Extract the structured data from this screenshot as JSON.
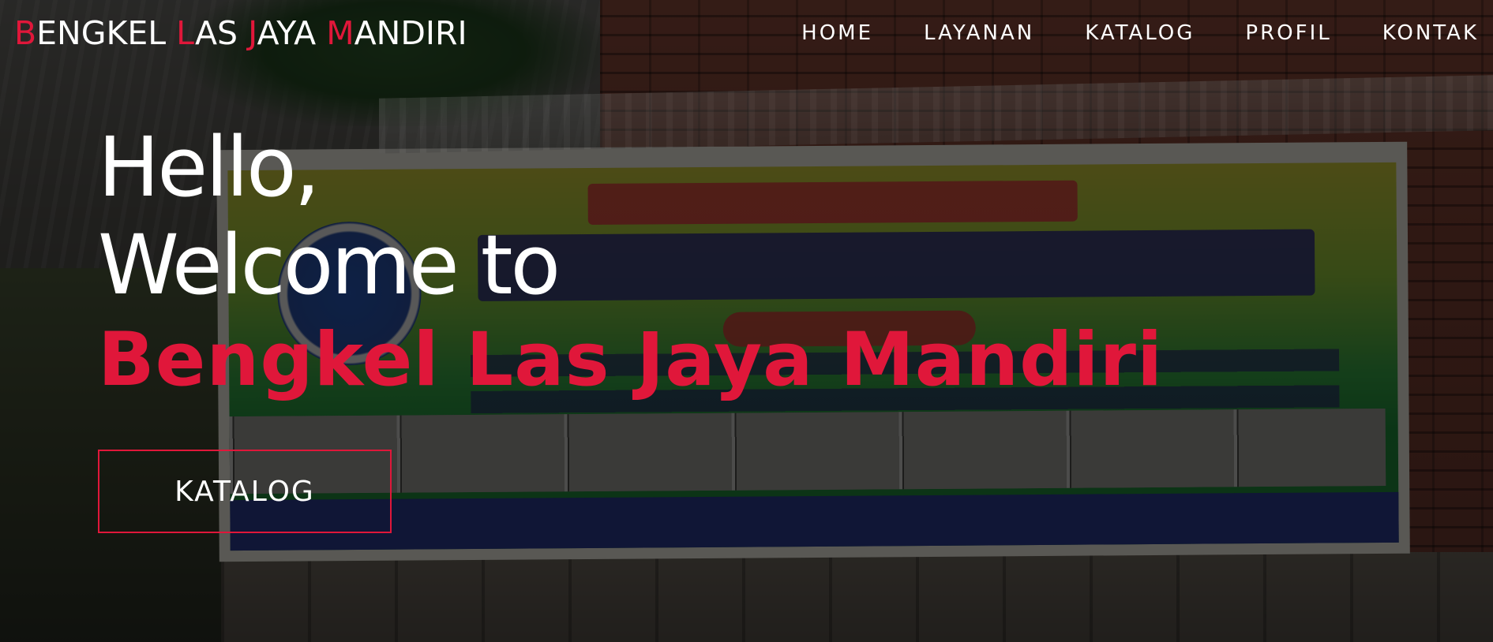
{
  "brand": {
    "parts": [
      {
        "text": "B",
        "accent": true
      },
      {
        "text": "ENGKEL ",
        "accent": false
      },
      {
        "text": "L",
        "accent": true
      },
      {
        "text": "AS ",
        "accent": false
      },
      {
        "text": "J",
        "accent": true
      },
      {
        "text": "AYA ",
        "accent": false
      },
      {
        "text": "M",
        "accent": true
      },
      {
        "text": "ANDIRI",
        "accent": false
      }
    ]
  },
  "nav": {
    "items": [
      {
        "label": "HOME"
      },
      {
        "label": "LAYANAN"
      },
      {
        "label": "KATALOG"
      },
      {
        "label": "PROFIL"
      },
      {
        "label": "KONTAK"
      }
    ]
  },
  "hero": {
    "line1": "Hello,",
    "line2": "Welcome to",
    "company": "Bengkel Las Jaya Mandiri",
    "cta_label": "KATALOG"
  },
  "colors": {
    "accent": "#e0173a",
    "text": "#ffffff",
    "overlay": "rgba(0,0,0,0.62)"
  }
}
